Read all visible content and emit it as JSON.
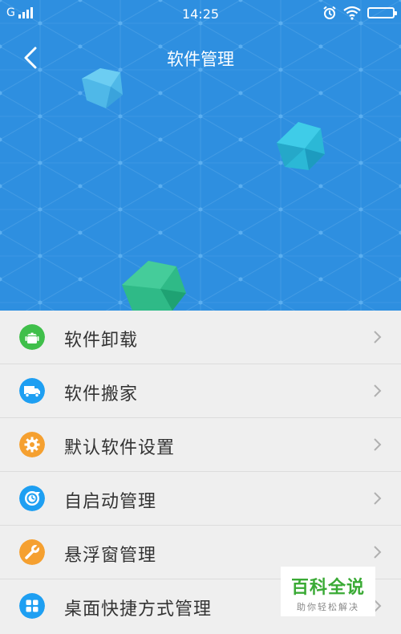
{
  "status_bar": {
    "network": "G",
    "time": "14:25",
    "icons": [
      "signal-icon",
      "alarm-icon",
      "wifi-icon",
      "battery-icon"
    ]
  },
  "header": {
    "title": "软件管理",
    "back_icon": "chevron-left-icon"
  },
  "menu": {
    "items": [
      {
        "label": "软件卸载",
        "icon": "android-icon",
        "color": "#3fbf4a"
      },
      {
        "label": "软件搬家",
        "icon": "truck-icon",
        "color": "#1e9ff2"
      },
      {
        "label": "默认软件设置",
        "icon": "gear-icon",
        "color": "#f5a030"
      },
      {
        "label": "自启动管理",
        "icon": "power-cycle-icon",
        "color": "#1e9ff2"
      },
      {
        "label": "悬浮窗管理",
        "icon": "wrench-icon",
        "color": "#f5a030"
      },
      {
        "label": "桌面快捷方式管理",
        "icon": "grid-icon",
        "color": "#1e9ff2"
      }
    ]
  },
  "watermark": {
    "main": "百科全说",
    "sub": "助你轻松解决"
  },
  "colors": {
    "header_bg": "#2e8fe0",
    "list_bg": "#efefef",
    "text": "#333333",
    "chevron": "#b0b0b0"
  }
}
